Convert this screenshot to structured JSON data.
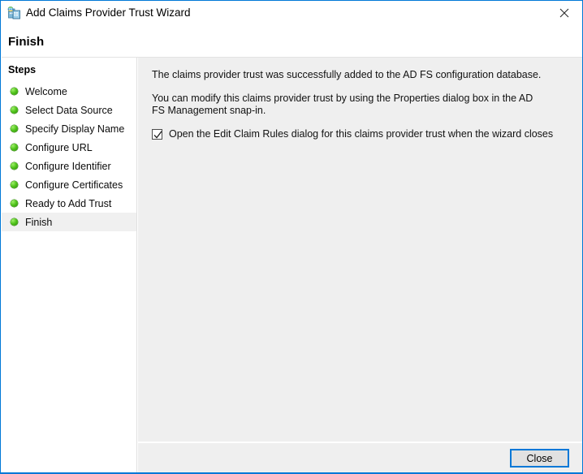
{
  "window": {
    "title": "Add Claims Provider Trust Wizard",
    "icon": "adfs-claims-provider-icon",
    "close_glyph": "✕",
    "accent_color": "#0078d7"
  },
  "page": {
    "heading": "Finish"
  },
  "sidebar": {
    "title": "Steps",
    "items": [
      {
        "label": "Welcome",
        "state": "done"
      },
      {
        "label": "Select Data Source",
        "state": "done"
      },
      {
        "label": "Specify Display Name",
        "state": "done"
      },
      {
        "label": "Configure URL",
        "state": "done"
      },
      {
        "label": "Configure Identifier",
        "state": "done"
      },
      {
        "label": "Configure Certificates",
        "state": "done"
      },
      {
        "label": "Ready to Add Trust",
        "state": "done"
      },
      {
        "label": "Finish",
        "state": "current"
      }
    ],
    "bullet_color": "#4fc21a",
    "current_highlight_color": "#f0f0f0"
  },
  "content": {
    "paragraph_1": "The claims provider trust was successfully added to the AD FS configuration database.",
    "paragraph_2": "You can modify this claims provider trust by using the Properties dialog box in the AD FS Management snap-in.",
    "checkbox": {
      "label": "Open the Edit Claim Rules dialog for this claims provider trust when the wizard closes",
      "checked": true
    }
  },
  "footer": {
    "close_label": "Close"
  }
}
